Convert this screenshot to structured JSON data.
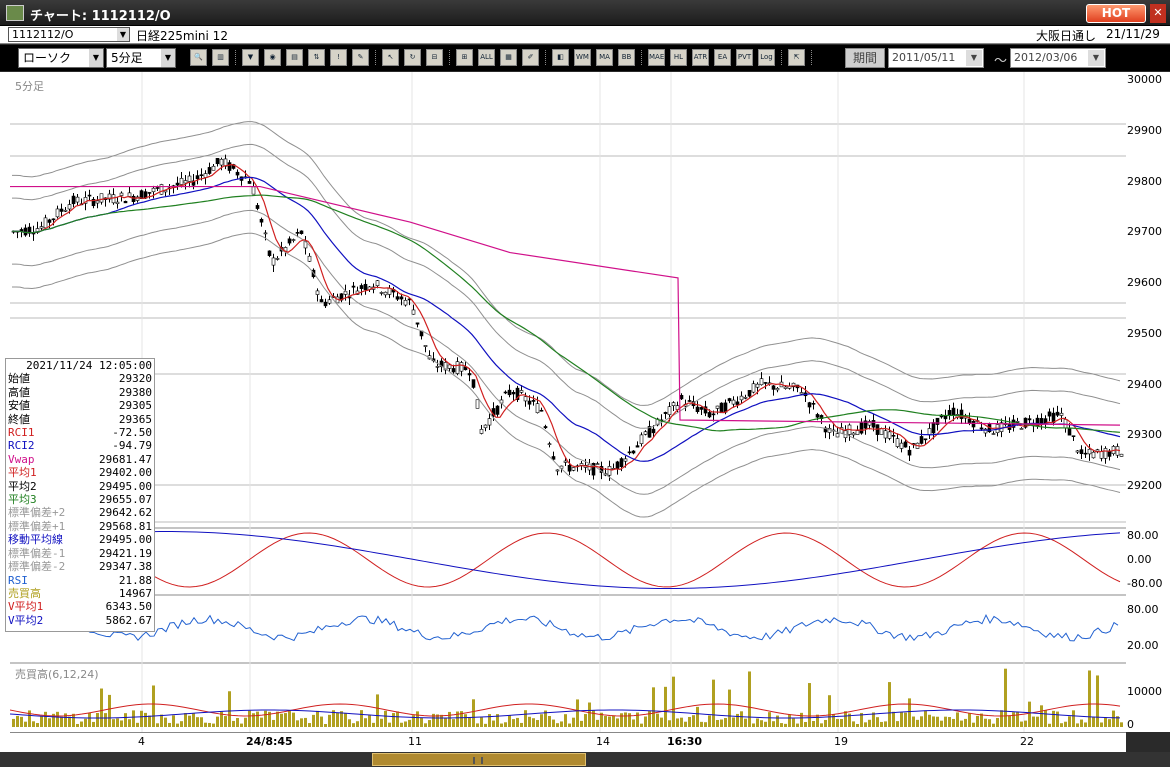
{
  "window": {
    "title": "チャート: 1112112/O",
    "hot_label": "HOT"
  },
  "info": {
    "symbol": "1112112/O",
    "name": "日経225mini 12",
    "session": "大阪日通し",
    "date": "21/11/29"
  },
  "toolbar": {
    "chart_type": "ローソク",
    "interval": "5分足",
    "period_label": "期間",
    "date_from": "2011/05/11",
    "date_to": "2012/03/06",
    "buttons": [
      "zoom",
      "bar",
      "pos",
      "ord",
      "cnd",
      "tick",
      "warn",
      "pen",
      "cursor",
      "cmp",
      "l1",
      "l2",
      "all",
      "trd",
      "edit",
      "color",
      "wma",
      "ma",
      "bb",
      "mae",
      "hl",
      "atr",
      "ea",
      "pvt",
      "log",
      "export"
    ]
  },
  "chart": {
    "timeframe_label": "5分足",
    "volume_label": "売買高(6,12,24)",
    "price_ticks": [
      "30000",
      "29900",
      "29800",
      "29700",
      "29600",
      "29500",
      "29400",
      "29300",
      "29200"
    ],
    "rci_ticks": [
      "80.00",
      "0.00",
      "-80.00"
    ],
    "rsi_ticks": [
      "80.00",
      "20.00"
    ],
    "vol_ticks": [
      "10000",
      "0"
    ],
    "x_labels": [
      {
        "t": "4"
      },
      {
        "t": "24/8:45",
        "bold": true
      },
      {
        "t": "11"
      },
      {
        "t": "14"
      },
      {
        "t": "16:30",
        "bold": true
      },
      {
        "t": "19"
      },
      {
        "t": "22"
      }
    ],
    "colors": {
      "up": "#ffffff",
      "down": "#000000",
      "avg1": "#d02020",
      "avg2": "#1010c0",
      "avg3": "#208020",
      "vwap": "#d0108a",
      "band": "#909090",
      "rsi": "#2060d0",
      "vol": "#b0a020"
    }
  },
  "panel": {
    "datetime": "2021/11/24 12:05:00",
    "rows": [
      {
        "k": "始値",
        "v": "29320",
        "c": "#000"
      },
      {
        "k": "高値",
        "v": "29380",
        "c": "#000"
      },
      {
        "k": "安値",
        "v": "29305",
        "c": "#000"
      },
      {
        "k": "終値",
        "v": "29365",
        "c": "#000"
      },
      {
        "k": "RCI1",
        "v": "-72.50",
        "c": "#d02020"
      },
      {
        "k": "RCI2",
        "v": "-94.79",
        "c": "#1010c0"
      },
      {
        "k": "Vwap",
        "v": "29681.47",
        "c": "#d0108a"
      },
      {
        "k": "平均1",
        "v": "29402.00",
        "c": "#d02020"
      },
      {
        "k": "平均2",
        "v": "29495.00",
        "c": "#000"
      },
      {
        "k": "平均3",
        "v": "29655.07",
        "c": "#208020"
      },
      {
        "k": "標準偏差+2",
        "v": "29642.62",
        "c": "#999"
      },
      {
        "k": "標準偏差+1",
        "v": "29568.81",
        "c": "#999"
      },
      {
        "k": "移動平均線",
        "v": "29495.00",
        "c": "#1010c0"
      },
      {
        "k": "標準偏差-1",
        "v": "29421.19",
        "c": "#999"
      },
      {
        "k": "標準偏差-2",
        "v": "29347.38",
        "c": "#999"
      },
      {
        "k": "RSI",
        "v": "21.88",
        "c": "#2060d0"
      },
      {
        "k": "売買高",
        "v": "14967",
        "c": "#b0a020"
      },
      {
        "k": "V平均1",
        "v": "6343.50",
        "c": "#d02020"
      },
      {
        "k": "V平均2",
        "v": "5862.67",
        "c": "#1010c0"
      }
    ]
  }
}
